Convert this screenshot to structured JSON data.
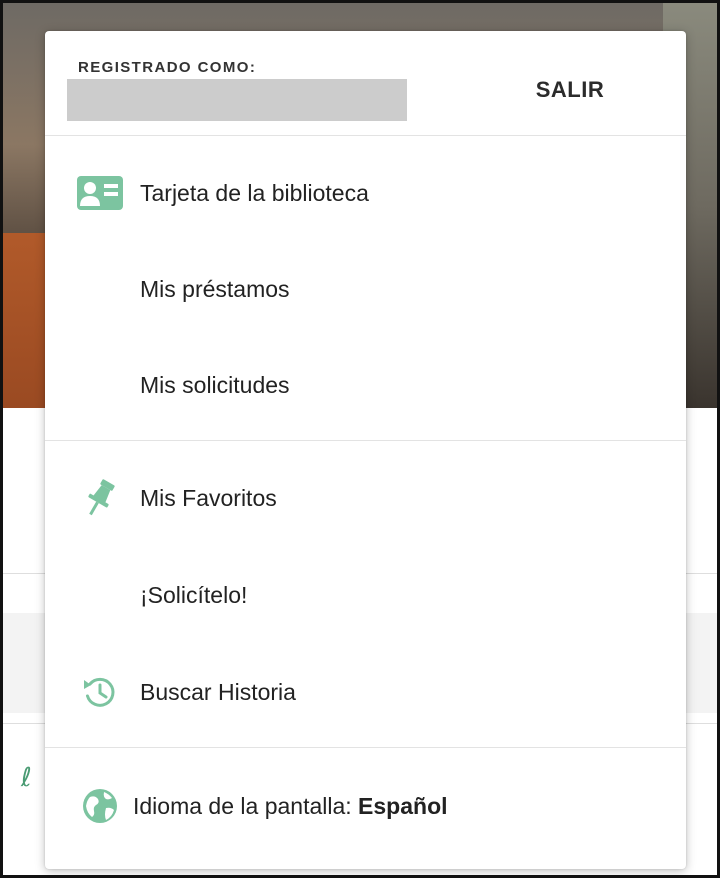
{
  "header": {
    "registered_label": "REGISTRADO COMO:",
    "logout_label": "SALIR"
  },
  "account_section": {
    "items": [
      {
        "label": "Tarjeta de la biblioteca",
        "icon": "library-card-icon"
      },
      {
        "label": "Mis préstamos"
      },
      {
        "label": "Mis solicitudes"
      }
    ]
  },
  "tools_section": {
    "items": [
      {
        "label": "Mis Favoritos",
        "icon": "pushpin-icon"
      },
      {
        "label": "¡Solicítelo!"
      },
      {
        "label": "Buscar Historia",
        "icon": "history-icon"
      }
    ]
  },
  "language": {
    "prefix": "Idioma de la pantalla: ",
    "value": "Español",
    "icon": "globe-icon"
  },
  "colors": {
    "accent": "#7cc4a0",
    "text": "#222222",
    "redaction": "#cccccc"
  }
}
